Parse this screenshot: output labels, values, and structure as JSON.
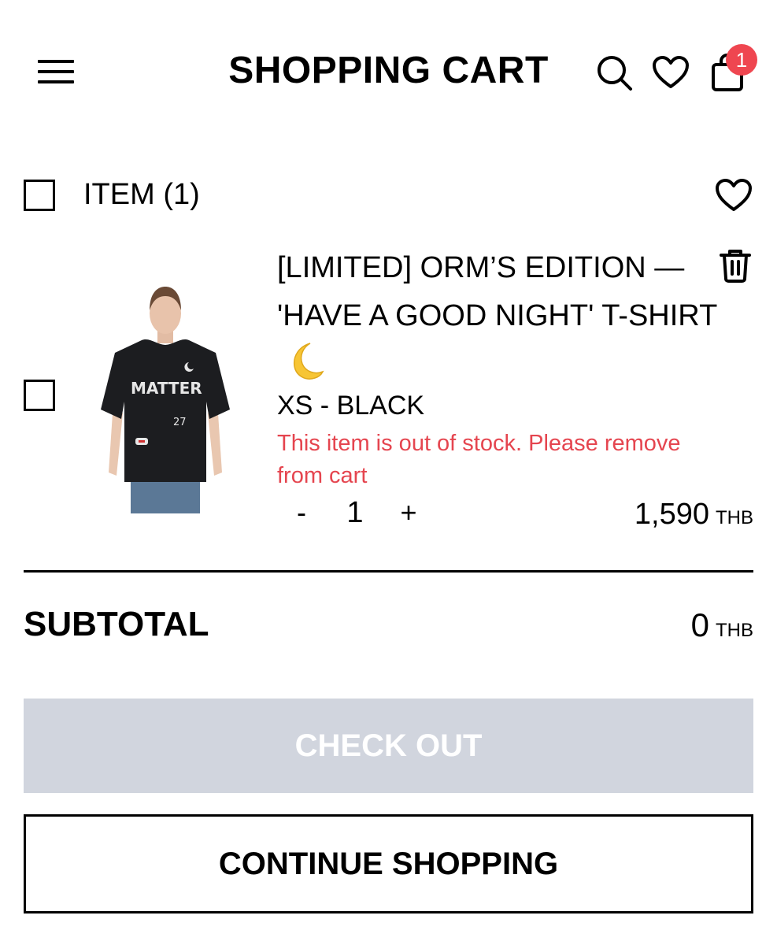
{
  "header": {
    "title": "SHOPPING CART",
    "cart_count": "1"
  },
  "cart": {
    "items_label": "ITEM (1)",
    "item": {
      "name": "[LIMITED] ORM’S EDITION — 'HAVE A GOOD NIGHT' T-SHIRT",
      "variant": "XS - BLACK",
      "stock_warning": "This item is out of stock. Please remove from cart",
      "qty_minus": "-",
      "quantity": "1",
      "qty_plus": "+",
      "price": "1,590",
      "currency": "THB",
      "print_text_main": "MATTER",
      "print_text_small": "27"
    }
  },
  "summary": {
    "subtotal_label": "SUBTOTAL",
    "subtotal_value": "0",
    "currency": "THB"
  },
  "actions": {
    "checkout_label": "CHECK OUT",
    "continue_label": "CONTINUE SHOPPING"
  },
  "colors": {
    "badge": "#ef4650",
    "warning": "#e5454f",
    "checkout_disabled_bg": "#d1d5de"
  }
}
